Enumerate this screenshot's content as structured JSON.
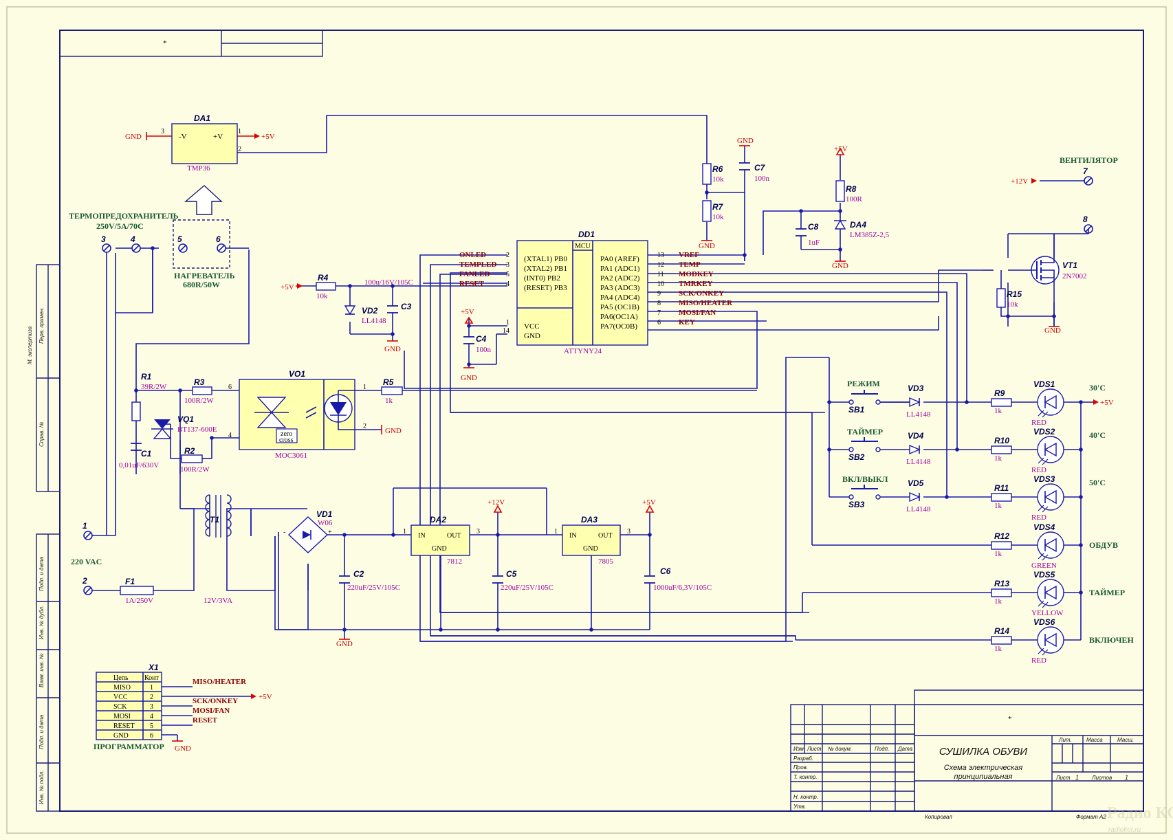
{
  "colors": {
    "background": "#fdfde4",
    "wire": "#1a1aaa",
    "component_fill": "#ffffb0",
    "power": "#dd0000",
    "signal": "#8b0000",
    "value": "#a000a0",
    "label": "#1a5a30"
  },
  "stamp_top": "*",
  "side_labels": [
    "Перв. примен.",
    "М. экспертиза",
    "Справ. №",
    "Подп. и дата",
    "Инв. № дубл.",
    "Взам. инв. №",
    "Подп. и дата",
    "Инв. № подл."
  ],
  "components": {
    "da1": {
      "ref": "DA1",
      "value": "TMP36",
      "pin_left": "-V",
      "pin_right": "+V",
      "pin3": "3",
      "pin1": "1",
      "pin2": "2"
    },
    "dd1": {
      "ref": "DD1",
      "value": "ATTYNY24",
      "mcu": "MCU",
      "left_pins": [
        "(XTAL1) PB0",
        "(XTAL2) PB1",
        "(INT0) PB2",
        "(RESET) PB3"
      ],
      "left_nums": [
        "2",
        "3",
        "5",
        "4"
      ],
      "right_pins": [
        "PA0 (AREF)",
        "PA1 (ADC1)",
        "PA2 (ADC2)",
        "PA3 (ADC3)",
        "PA4 (ADC4)",
        "PA5 (OC1B)",
        "PA6(OC1A)",
        "PA7(OC0B)"
      ],
      "right_nums": [
        "13",
        "12",
        "11",
        "10",
        "9",
        "8",
        "7",
        "6"
      ],
      "pwr_pins": [
        "VCC",
        "GND"
      ],
      "pwr_nums": [
        "1",
        "14"
      ]
    },
    "vo1": {
      "ref": "VO1",
      "value": "MOC3061",
      "zc1": "zero",
      "zc2": "cross",
      "p6": "6",
      "p4": "4",
      "p1": "1",
      "p2": "2"
    },
    "vq1": {
      "ref": "VQ1",
      "value": "BT137-600E"
    },
    "vt1": {
      "ref": "VT1",
      "value": "2N7002"
    },
    "da2": {
      "ref": "DA2",
      "value": "7812",
      "in": "IN",
      "out": "OUT",
      "gnd": "GND",
      "p1": "1",
      "p2": "2",
      "p3": "3"
    },
    "da3": {
      "ref": "DA3",
      "value": "7805",
      "in": "IN",
      "out": "OUT",
      "gnd": "GND",
      "p1": "1",
      "p2": "2",
      "p3": "3"
    },
    "da4": {
      "ref": "DA4",
      "value": "LM385Z-2,5"
    },
    "vd1": {
      "ref": "VD1",
      "value": "W06"
    },
    "vd2": {
      "ref": "VD2",
      "value": "LL4148"
    },
    "vd3": {
      "ref": "VD3",
      "value": "LL4148"
    },
    "vd4": {
      "ref": "VD4",
      "value": "LL4148"
    },
    "vd5": {
      "ref": "VD5",
      "value": "LL4148"
    },
    "t1": {
      "ref": "T1",
      "value": "12V/3VA"
    },
    "f1": {
      "ref": "F1",
      "value": "1A/250V"
    },
    "r1": {
      "ref": "R1",
      "value": "39R/2W"
    },
    "r2": {
      "ref": "R2",
      "value": "100R/2W"
    },
    "r3": {
      "ref": "R3",
      "value": "100R/2W"
    },
    "r4": {
      "ref": "R4",
      "value": "10k"
    },
    "r5": {
      "ref": "R5",
      "value": "1k"
    },
    "r6": {
      "ref": "R6",
      "value": "10k"
    },
    "r7": {
      "ref": "R7",
      "value": "10k"
    },
    "r8": {
      "ref": "R8",
      "value": "100R"
    },
    "r9": {
      "ref": "R9",
      "value": "1k"
    },
    "r10": {
      "ref": "R10",
      "value": "1k"
    },
    "r11": {
      "ref": "R11",
      "value": "1k"
    },
    "r12": {
      "ref": "R12",
      "value": "1k"
    },
    "r13": {
      "ref": "R13",
      "value": "1k"
    },
    "r14": {
      "ref": "R14",
      "value": "1k"
    },
    "r15": {
      "ref": "R15",
      "value": "10k"
    },
    "c1": {
      "ref": "C1",
      "value": "0,01uF/630V"
    },
    "c2": {
      "ref": "C2",
      "value": "220uF/25V/105C"
    },
    "c3": {
      "ref": "C3",
      "value": "100u/16V/105C"
    },
    "c4": {
      "ref": "C4",
      "value": "100n"
    },
    "c5": {
      "ref": "C5",
      "value": "220uF/25V/105C"
    },
    "c6": {
      "ref": "C6",
      "value": "1000uF/6,3V/105C"
    },
    "c7": {
      "ref": "C7",
      "value": "100n"
    },
    "c8": {
      "ref": "C8",
      "value": "1uF"
    },
    "sb1": {
      "ref": "SB1",
      "label": "РЕЖИМ"
    },
    "sb2": {
      "ref": "SB2",
      "label": "ТАЙМЕР"
    },
    "sb3": {
      "ref": "SB3",
      "label": "ВКЛ/ВЫКЛ"
    },
    "vds1": {
      "ref": "VDS1",
      "value": "RED",
      "label": "30'C"
    },
    "vds2": {
      "ref": "VDS2",
      "value": "RED",
      "label": "40'C"
    },
    "vds3": {
      "ref": "VDS3",
      "value": "RED",
      "label": "50'C"
    },
    "vds4": {
      "ref": "VDS4",
      "value": "GREEN",
      "label": "ОБДУВ"
    },
    "vds5": {
      "ref": "VDS5",
      "value": "YELLOW",
      "label": "ТАЙМЕР"
    },
    "vds6": {
      "ref": "VDS6",
      "value": "RED",
      "label": "ВКЛЮЧЕН"
    }
  },
  "nets": {
    "onled": "ONLED",
    "templed": "TEMPLED",
    "fanled": "FANLED",
    "reset": "RESET",
    "vref": "VREF",
    "temp": "TEMP",
    "modkey": "MODKEY",
    "tmrkey": "TMRKEY",
    "sck": "SCK/ONKEY",
    "miso": "MISO/HEATER",
    "mosi": "MOSI/FAN",
    "key": "KEY"
  },
  "power": {
    "gnd": "GND",
    "p5": "+5V",
    "p12": "+12V"
  },
  "terminals": {
    "t1": "1",
    "t2": "2",
    "t3": "3",
    "t4": "4",
    "t5": "5",
    "t6": "6",
    "t7": "7",
    "t8": "8",
    "thermofuse": "ТЕРМОПРЕДОХРАНИТЕЛЬ",
    "thermofuse_spec": "250V/5A/70C",
    "heater": "НАГРЕВАТЕЛЬ",
    "heater_spec": "680R/50W",
    "mains": "220 VAC",
    "fan": "ВЕНТИЛЯТОР"
  },
  "programmer": {
    "ref": "X1",
    "title": "ПРОГРАММАТОР",
    "col1": "Цепь",
    "col2": "Конт",
    "rows": [
      [
        "MISO",
        "1"
      ],
      [
        "VCC",
        "2"
      ],
      [
        "SCK",
        "3"
      ],
      [
        "MOSI",
        "4"
      ],
      [
        "RESET",
        "5"
      ],
      [
        "GND",
        "6"
      ]
    ],
    "nets": [
      "MISO/HEATER",
      "+5V",
      "SCK/ONKEY",
      "MOSI/FAN",
      "RESET",
      "GND"
    ]
  },
  "title_block": {
    "star": "*",
    "headers": [
      "Изм",
      "Лист",
      "№ докум.",
      "Подп.",
      "Дата"
    ],
    "rows": [
      "Разраб.",
      "Пров.",
      "Т. контр.",
      "",
      "Н. контр.",
      "Утв."
    ],
    "title": "СУШИЛКА ОБУВИ",
    "subtitle1": "Схема электрическая",
    "subtitle2": "принципиальная",
    "lit": "Лит.",
    "mass": "Масса",
    "scale": "Масш.",
    "sheet": "Лист",
    "sheet_val": "1",
    "sheets": "Листов",
    "sheets_val": "1",
    "copied": "Копировал",
    "format": "Формат А2"
  },
  "watermark": {
    "logo": "Радио КОТ",
    "site": "radiokot.ru"
  }
}
